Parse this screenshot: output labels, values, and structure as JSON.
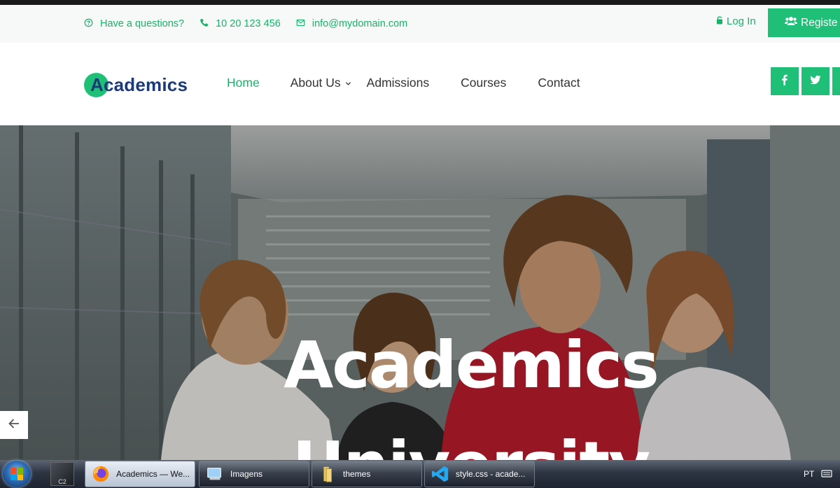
{
  "topbar": {
    "question": "Have a questions?",
    "phone": "10 20 123 456",
    "email": "info@mydomain.com",
    "login": "Log In",
    "register": "Registe"
  },
  "brand": {
    "logo_text": "Academics",
    "accent_color": "#1fbf77",
    "logo_color": "#1c3a78"
  },
  "nav": {
    "home": "Home",
    "about": "About Us",
    "admissions": "Admissions",
    "courses": "Courses",
    "contact": "Contact"
  },
  "social": [
    "facebook-icon",
    "twitter-icon"
  ],
  "hero": {
    "title_line1": "Academics",
    "title_line2": "University"
  },
  "taskbar": {
    "items": [
      {
        "label": "Academics — We..."
      },
      {
        "label": "Imagens"
      },
      {
        "label": "themes"
      },
      {
        "label": "style.css - acade..."
      }
    ],
    "language": "PT"
  }
}
